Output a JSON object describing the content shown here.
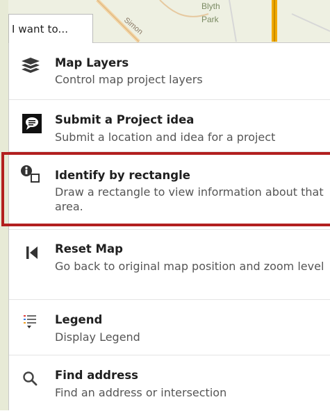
{
  "tab": {
    "label": "I want to..."
  },
  "map": {
    "labels": [
      "Simon",
      "Blyth",
      "Park"
    ]
  },
  "menu": {
    "items": [
      {
        "title": "Map Layers",
        "desc": "Control map project layers",
        "icon": "layers-icon"
      },
      {
        "title": "Submit a Project idea",
        "desc": "Submit a location and idea for a project",
        "icon": "comment-icon"
      },
      {
        "title": "Identify by rectangle",
        "desc": "Draw a rectangle to view information about that area.",
        "icon": "identify-rectangle-icon"
      },
      {
        "title": "Reset Map",
        "desc": "Go back to original map position and zoom level",
        "icon": "reset-map-icon"
      },
      {
        "title": "Legend",
        "desc": "Display Legend",
        "icon": "legend-icon"
      },
      {
        "title": "Find address",
        "desc": "Find an address or intersection",
        "icon": "search-icon"
      }
    ]
  },
  "colors": {
    "highlight": "#b21f1f",
    "title": "#1f1f1f",
    "desc": "#555555"
  }
}
